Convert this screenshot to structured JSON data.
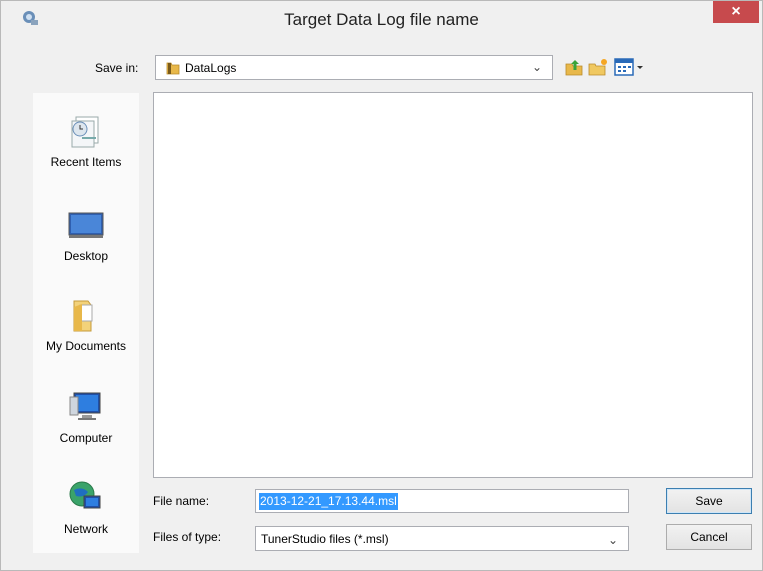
{
  "window": {
    "title": "Target Data Log file name"
  },
  "toolbar": {
    "save_in_label": "Save in:",
    "save_in_value": "DataLogs"
  },
  "places": [
    {
      "label": "Recent Items"
    },
    {
      "label": "Desktop"
    },
    {
      "label": "My Documents"
    },
    {
      "label": "Computer"
    },
    {
      "label": "Network"
    }
  ],
  "form": {
    "file_name_label": "File name:",
    "file_name_value": "2013-12-21_17.13.44.msl",
    "file_type_label": "Files of type:",
    "file_type_value": "TunerStudio files (*.msl)"
  },
  "buttons": {
    "save": "Save",
    "cancel": "Cancel",
    "close": "×"
  },
  "colors": {
    "close": "#c74a4d",
    "selection": "#3399ff",
    "folder": "#e8b84a"
  }
}
